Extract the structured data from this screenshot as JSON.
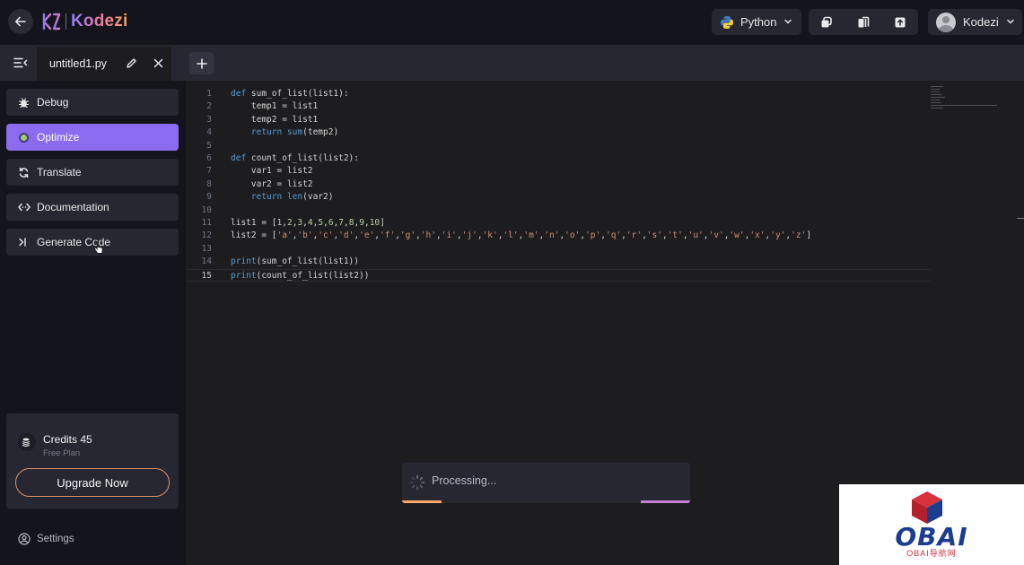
{
  "header": {
    "brand": "Kodezi",
    "language": "Python",
    "user_name": "Kodezi"
  },
  "tabs": {
    "file_name": "untitled1.py"
  },
  "sidebar": {
    "items": [
      {
        "label": "Debug",
        "icon": "bug-icon"
      },
      {
        "label": "Optimize",
        "icon": "optimize-icon",
        "active": true
      },
      {
        "label": "Translate",
        "icon": "translate-icon"
      },
      {
        "label": "Documentation",
        "icon": "code-icon"
      },
      {
        "label": "Generate Code",
        "icon": "terminal-icon"
      }
    ],
    "credits_label": "Credits 45",
    "plan_label": "Free Plan",
    "upgrade_label": "Upgrade Now",
    "settings_label": "Settings"
  },
  "editor": {
    "current_line": 15,
    "lines": [
      {
        "n": "1",
        "tokens": [
          [
            "kw",
            "def"
          ],
          [
            "fn",
            " sum_of_list(list1):"
          ]
        ]
      },
      {
        "n": "2",
        "tokens": [
          [
            "fn",
            "    temp1 = list1"
          ]
        ]
      },
      {
        "n": "3",
        "tokens": [
          [
            "fn",
            "    temp2 = list1"
          ]
        ]
      },
      {
        "n": "4",
        "tokens": [
          [
            "fn",
            "    "
          ],
          [
            "kw",
            "return"
          ],
          [
            "fn",
            " "
          ],
          [
            "kw",
            "sum"
          ],
          [
            "fn",
            "(temp2)"
          ]
        ]
      },
      {
        "n": "5",
        "tokens": []
      },
      {
        "n": "6",
        "tokens": [
          [
            "kw",
            "def"
          ],
          [
            "fn",
            " count_of_list(list2):"
          ]
        ]
      },
      {
        "n": "7",
        "tokens": [
          [
            "fn",
            "    var1 = list2"
          ]
        ]
      },
      {
        "n": "8",
        "tokens": [
          [
            "fn",
            "    var2 = list2"
          ]
        ]
      },
      {
        "n": "9",
        "tokens": [
          [
            "fn",
            "    "
          ],
          [
            "kw",
            "return"
          ],
          [
            "fn",
            " "
          ],
          [
            "kw",
            "len"
          ],
          [
            "fn",
            "(var2)"
          ]
        ]
      },
      {
        "n": "10",
        "tokens": []
      },
      {
        "n": "11",
        "tokens": [
          [
            "fn",
            "list1 = ["
          ],
          [
            "num",
            "1"
          ],
          [
            "fn",
            ","
          ],
          [
            "num",
            "2"
          ],
          [
            "fn",
            ","
          ],
          [
            "num",
            "3"
          ],
          [
            "fn",
            ","
          ],
          [
            "num",
            "4"
          ],
          [
            "fn",
            ","
          ],
          [
            "num",
            "5"
          ],
          [
            "fn",
            ","
          ],
          [
            "num",
            "6"
          ],
          [
            "fn",
            ","
          ],
          [
            "num",
            "7"
          ],
          [
            "fn",
            ","
          ],
          [
            "num",
            "8"
          ],
          [
            "fn",
            ","
          ],
          [
            "num",
            "9"
          ],
          [
            "fn",
            ","
          ],
          [
            "num",
            "10"
          ],
          [
            "fn",
            "]"
          ]
        ]
      },
      {
        "n": "12",
        "tokens": [
          [
            "fn",
            "list2 = ["
          ],
          [
            "str",
            "'a'"
          ],
          [
            "fn",
            ","
          ],
          [
            "str",
            "'b'"
          ],
          [
            "fn",
            ","
          ],
          [
            "str",
            "'c'"
          ],
          [
            "fn",
            ","
          ],
          [
            "str",
            "'d'"
          ],
          [
            "fn",
            ","
          ],
          [
            "str",
            "'e'"
          ],
          [
            "fn",
            ","
          ],
          [
            "str",
            "'f'"
          ],
          [
            "fn",
            ","
          ],
          [
            "str",
            "'g'"
          ],
          [
            "fn",
            ","
          ],
          [
            "str",
            "'h'"
          ],
          [
            "fn",
            ","
          ],
          [
            "str",
            "'i'"
          ],
          [
            "fn",
            ","
          ],
          [
            "str",
            "'j'"
          ],
          [
            "fn",
            ","
          ],
          [
            "str",
            "'k'"
          ],
          [
            "fn",
            ","
          ],
          [
            "str",
            "'l'"
          ],
          [
            "fn",
            ","
          ],
          [
            "str",
            "'m'"
          ],
          [
            "fn",
            ","
          ],
          [
            "str",
            "'n'"
          ],
          [
            "fn",
            ","
          ],
          [
            "str",
            "'o'"
          ],
          [
            "fn",
            ","
          ],
          [
            "str",
            "'p'"
          ],
          [
            "fn",
            ","
          ],
          [
            "str",
            "'q'"
          ],
          [
            "fn",
            ","
          ],
          [
            "str",
            "'r'"
          ],
          [
            "fn",
            ","
          ],
          [
            "str",
            "'s'"
          ],
          [
            "fn",
            ","
          ],
          [
            "str",
            "'t'"
          ],
          [
            "fn",
            ","
          ],
          [
            "str",
            "'u'"
          ],
          [
            "fn",
            ","
          ],
          [
            "str",
            "'v'"
          ],
          [
            "fn",
            ","
          ],
          [
            "str",
            "'w'"
          ],
          [
            "fn",
            ","
          ],
          [
            "str",
            "'x'"
          ],
          [
            "fn",
            ","
          ],
          [
            "str",
            "'y'"
          ],
          [
            "fn",
            ","
          ],
          [
            "str",
            "'z'"
          ],
          [
            "fn",
            "]"
          ]
        ]
      },
      {
        "n": "13",
        "tokens": []
      },
      {
        "n": "14",
        "tokens": [
          [
            "kw",
            "print"
          ],
          [
            "fn",
            "(sum_of_list(list1))"
          ]
        ]
      },
      {
        "n": "15",
        "tokens": [
          [
            "kw",
            "print"
          ],
          [
            "fn",
            "(count_of_list(list2))"
          ]
        ]
      }
    ]
  },
  "toast": {
    "message": "Processing..."
  },
  "watermark": {
    "title": "OBAI",
    "subtitle": "OBAI导航网"
  },
  "colors": {
    "accent": "#8b6cf0",
    "upgrade_border": "#d7936a",
    "keyword": "#569cd6",
    "string": "#ce9178",
    "number": "#b5cea8"
  }
}
